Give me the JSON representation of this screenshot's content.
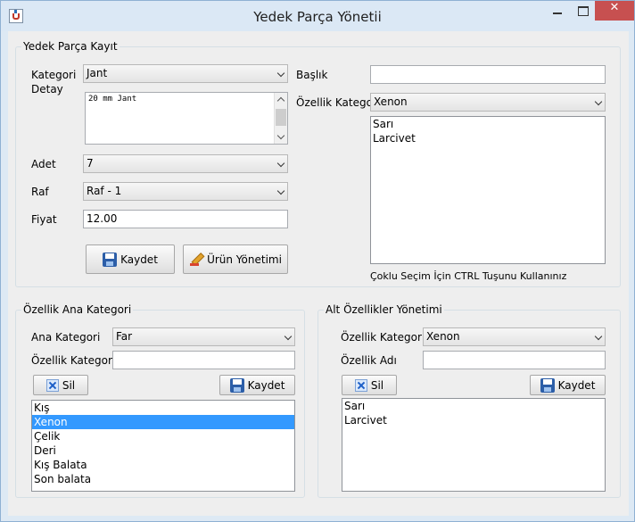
{
  "window": {
    "title": "Yedek Parça Yönetii"
  },
  "kayit": {
    "group_title": "Yedek Parça Kayıt",
    "kategori_label": "Kategori",
    "kategori_value": "Jant",
    "detay_label": "Detay",
    "detay_value": "20 mm Jant",
    "adet_label": "Adet",
    "adet_value": "7",
    "raf_label": "Raf",
    "raf_value": "Raf - 1",
    "fiyat_label": "Fiyat",
    "fiyat_value": "12.00",
    "kaydet_label": "Kaydet",
    "urun_yonetimi_label": "Ürün Yönetimi",
    "baslik_label": "Başlık",
    "baslik_value": "",
    "ozellik_kategori_label": "Özellik Kategori",
    "ozellik_kategori_value": "Xenon",
    "ozellik_items": [
      "Sarı",
      "Larcivet"
    ],
    "hint": "Çoklu Seçim İçin CTRL Tuşunu Kullanınız"
  },
  "ana": {
    "group_title": "Özellik Ana Kategori",
    "ana_kategori_label": "Ana Kategori",
    "ana_kategori_value": "Far",
    "ozellik_kategori_label": "Özellik Kategori",
    "ozellik_kategori_value": "",
    "sil_label": "Sil",
    "kaydet_label": "Kaydet",
    "items": [
      "Kış",
      "Xenon",
      "Çelik",
      "Deri",
      "Kış Balata",
      "Son balata"
    ],
    "selected_index": 1
  },
  "alt": {
    "group_title": "Alt Özellikler Yönetimi",
    "ozellik_kategori_label": "Özellik Kategori",
    "ozellik_kategori_value": "Xenon",
    "ozellik_adi_label": "Özellik Adı",
    "ozellik_adi_value": "",
    "sil_label": "Sil",
    "kaydet_label": "Kaydet",
    "items": [
      "Sarı",
      "Larcivet"
    ]
  }
}
